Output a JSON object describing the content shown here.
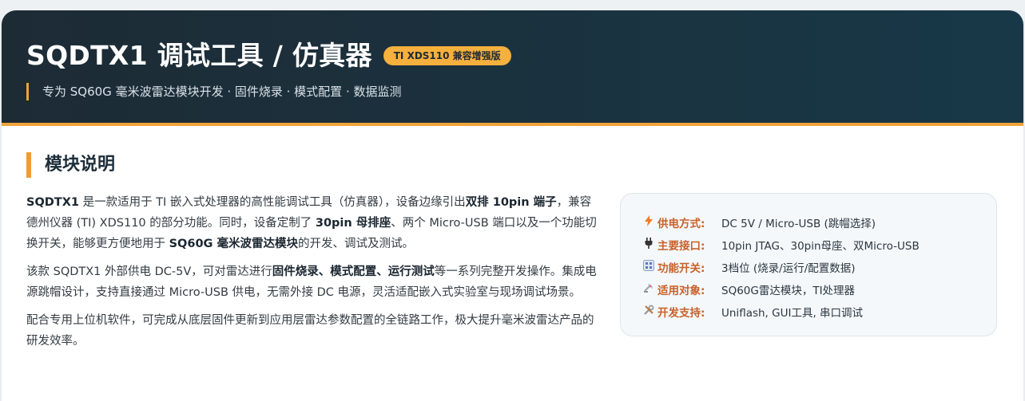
{
  "header": {
    "title": "SQDTX1 调试工具 / 仿真器",
    "badge": "TI XDS110 兼容增强版",
    "subtitle": "专为 SQ60G 毫米波雷达模块开发 · 固件烧录 · 模式配置 · 数据监测"
  },
  "section": {
    "title": "模块说明"
  },
  "paragraphs": {
    "p1": [
      {
        "text": "SQDTX1",
        "bold": true
      },
      {
        "text": " 是一款适用于 TI 嵌入式处理器的高性能调试工具（仿真器），设备边缘引出",
        "bold": false
      },
      {
        "text": "双排 10pin 端子",
        "bold": true
      },
      {
        "text": "，兼容德州仪器 (TI) XDS110 的部分功能。同时，设备定制了 ",
        "bold": false
      },
      {
        "text": "30pin 母排座",
        "bold": true
      },
      {
        "text": "、两个 Micro-USB 端口以及一个功能切换开关，能够更方便地用于 ",
        "bold": false
      },
      {
        "text": "SQ60G 毫米波雷达模块",
        "bold": true
      },
      {
        "text": "的开发、调试及测试。",
        "bold": false
      }
    ],
    "p2": [
      {
        "text": "该款 SQDTX1 外部供电 DC-5V，可对雷达进行",
        "bold": false
      },
      {
        "text": "固件烧录、模式配置、运行测试",
        "bold": true
      },
      {
        "text": "等一系列完整开发操作。集成电源跳帽设计，支持直接通过 Micro-USB 供电，无需外接 DC 电源，灵活适配嵌入式实验室与现场调试场景。",
        "bold": false
      }
    ],
    "p3": [
      {
        "text": "配合专用上位机软件，可完成从底层固件更新到应用层雷达参数配置的全链路工作，极大提升毫米波雷达产品的研发效率。",
        "bold": false
      }
    ]
  },
  "info": {
    "rows": [
      {
        "icon": "lightning-icon",
        "label": "供电方式:",
        "value": "DC 5V / Micro-USB (跳帽选择)"
      },
      {
        "icon": "plug-icon",
        "label": "主要接口:",
        "value": "10pin JTAG、30pin母座、双Micro-USB"
      },
      {
        "icon": "control-knobs-icon",
        "label": "功能开关:",
        "value": "3档位 (烧录/运行/配置数据)"
      },
      {
        "icon": "satellite-antenna-icon",
        "label": "适用对象:",
        "value": "SQ60G雷达模块，TI处理器"
      },
      {
        "icon": "tools-icon",
        "label": "开发支持:",
        "value": "Uniflash, GUI工具, 串口调试"
      }
    ]
  },
  "colors": {
    "header_bg": "#1d2b35",
    "accent": "#f0a33a",
    "label": "#c8612a"
  }
}
